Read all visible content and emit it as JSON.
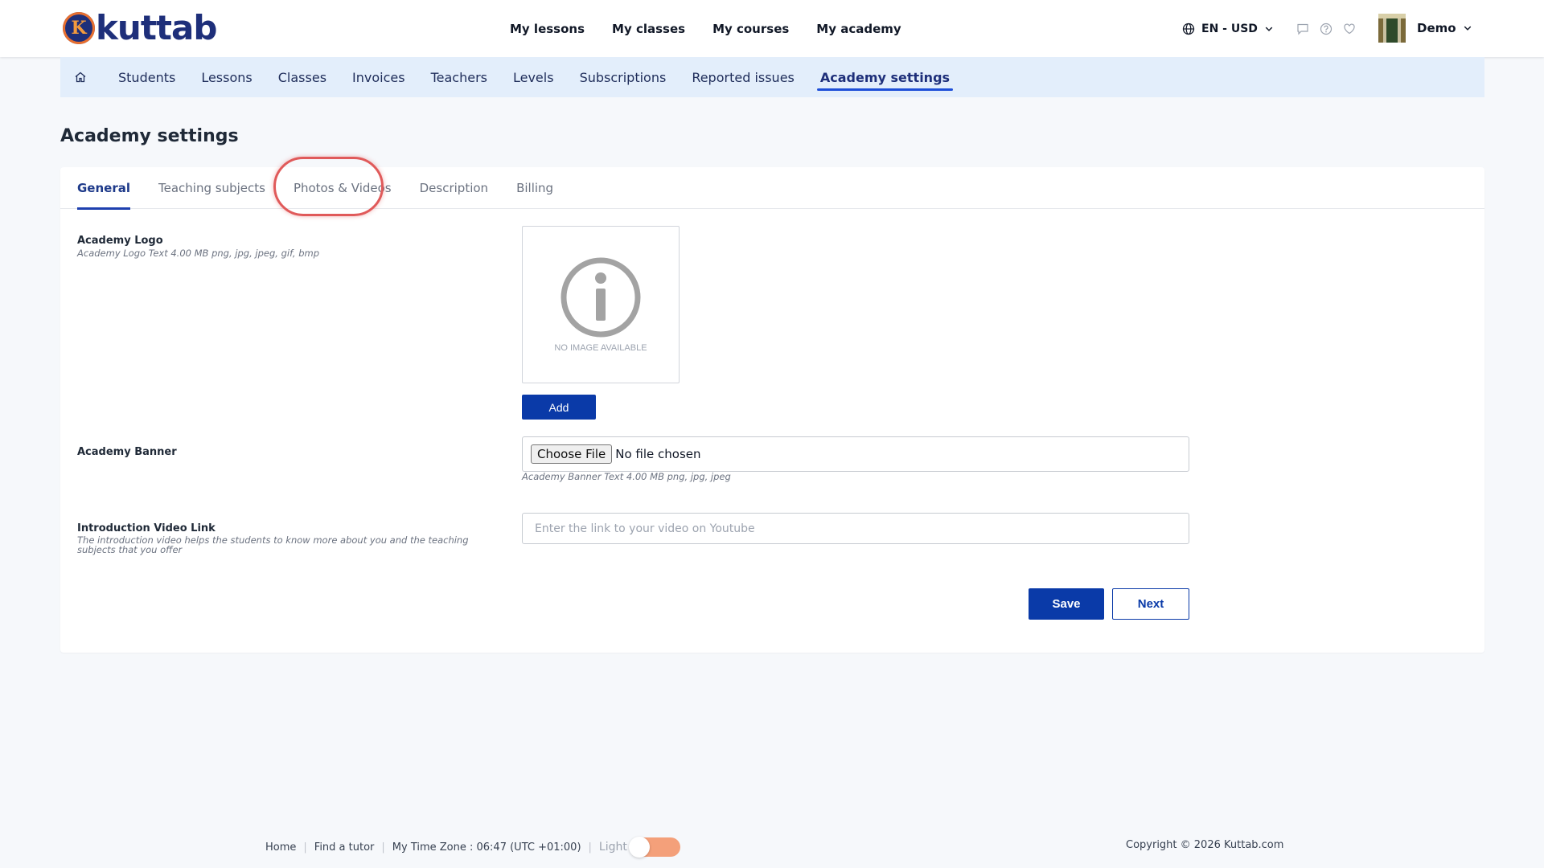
{
  "header": {
    "logo_letter": "K",
    "logo_text": "kuttab",
    "nav": [
      "My lessons",
      "My classes",
      "My courses",
      "My academy"
    ],
    "language": "EN - USD",
    "user_name": "Demo"
  },
  "subnav": {
    "items": [
      "Students",
      "Lessons",
      "Classes",
      "Invoices",
      "Teachers",
      "Levels",
      "Subscriptions",
      "Reported issues",
      "Academy settings"
    ],
    "active": "Academy settings"
  },
  "page": {
    "title": "Academy settings"
  },
  "tabs": {
    "items": [
      "General",
      "Teaching subjects",
      "Photos & Videos",
      "Description",
      "Billing"
    ],
    "active": "General"
  },
  "form": {
    "logo": {
      "label": "Academy Logo",
      "hint": "Academy Logo Text 4.00 MB png, jpg, jpeg, gif, bmp",
      "no_image_text": "NO IMAGE AVAILABLE",
      "add_label": "Add"
    },
    "banner": {
      "label": "Academy Banner",
      "choose_label": "Choose File",
      "file_status": "No file chosen",
      "hint": "Academy Banner Text 4.00 MB png, jpg, jpeg"
    },
    "video": {
      "label": "Introduction Video Link",
      "hint_line1": "The introduction video helps the students to know more about you and the teaching",
      "hint_line2": "subjects that you offer",
      "placeholder": "Enter the link to your video on Youtube",
      "value": ""
    },
    "save_label": "Save",
    "next_label": "Next"
  },
  "footer": {
    "links": [
      "Home",
      "Find a tutor",
      "My Time Zone : 06:47 (UTC +01:00)"
    ],
    "theme_label": "Light",
    "copyright": "Copyright © 2026 Kuttab.com"
  },
  "colors": {
    "brand": "#1e2f7a",
    "primary_button": "#0a3aa8",
    "subnav_bg": "#e3eefb",
    "highlight_ring": "#e05a5a",
    "toggle": "#f4a07a"
  }
}
